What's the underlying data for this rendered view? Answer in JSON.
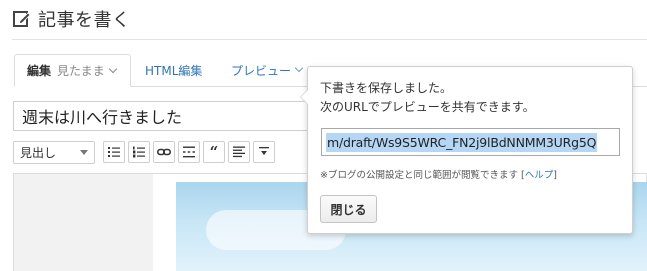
{
  "header": {
    "title": "記事を書く",
    "icon": "edit-pencil-icon"
  },
  "tabs": {
    "edit_label": "編集",
    "edit_mode": "見たまま",
    "html_label": "HTML編集",
    "preview_label": "プレビュー"
  },
  "editor": {
    "title_value": "週末は川へ行きました",
    "heading_select": "見出し",
    "toolbar_icons": [
      "bulleted-list-icon",
      "numbered-list-icon",
      "link-icon",
      "more-separator-icon",
      "quote-icon",
      "table-of-contents-icon",
      "footnote-icon"
    ],
    "quote_glyph": "“"
  },
  "popover": {
    "message_line1": "下書きを保存しました。",
    "message_line2": "次のURLでプレビューを共有できます。",
    "preview_url": "m/draft/Ws9S5WRC_FN2j9lBdNNMM3URg5Q",
    "note_text": "※ブログの公開設定と同じ範囲が閲覧できます [",
    "help_link": "ヘルプ",
    "note_close": "]",
    "close_button": "閉じる"
  },
  "colors": {
    "link_blue": "#2f76b5",
    "selection": "#b5d6f5"
  }
}
